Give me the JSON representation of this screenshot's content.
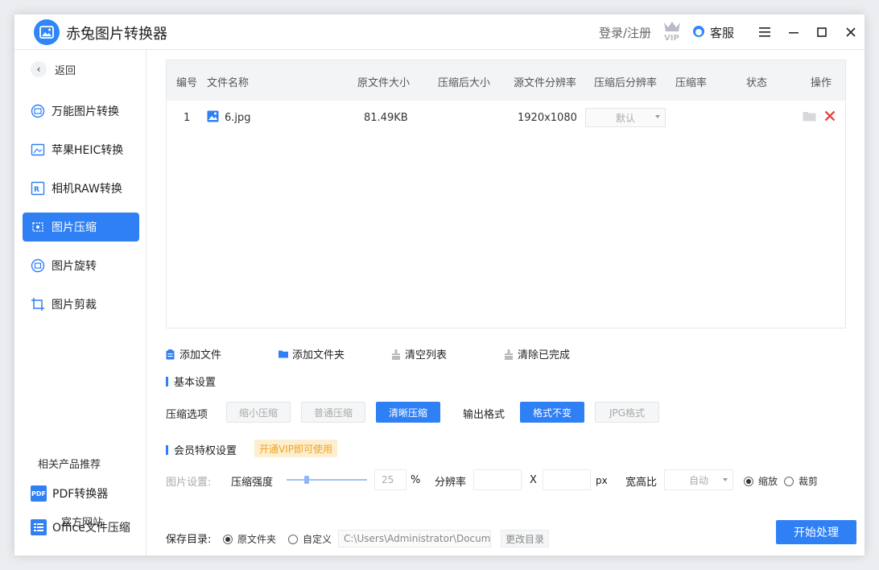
{
  "app": {
    "title": "赤兔图片转换器",
    "login": "登录/注册",
    "service": "客服"
  },
  "sidebar": {
    "back": "返回",
    "items": [
      {
        "label": "万能图片转换",
        "icon": "image-convert-icon"
      },
      {
        "label": "苹果HEIC转换",
        "icon": "heic-icon"
      },
      {
        "label": "相机RAW转换",
        "icon": "raw-icon"
      },
      {
        "label": "图片压缩",
        "icon": "compress-icon",
        "active": true
      },
      {
        "label": "图片旋转",
        "icon": "rotate-icon"
      },
      {
        "label": "图片剪裁",
        "icon": "crop-icon"
      }
    ],
    "recommend_title": "相关产品推荐",
    "recommend": [
      {
        "label": "PDF转换器",
        "icon_text": "PDF"
      },
      {
        "label": "Office文件压缩",
        "icon_text": ""
      }
    ],
    "official": "官方网站"
  },
  "table": {
    "headers": [
      "编号",
      "文件名称",
      "原文件大小",
      "压缩后大小",
      "源文件分辨率",
      "压缩后分辨率",
      "压缩率",
      "状态",
      "操作"
    ],
    "rows": [
      {
        "index": "1",
        "name": "6.jpg",
        "size": "81.49KB",
        "compressed": "",
        "resolution": "1920x1080",
        "target_res": "默认",
        "ratio": "",
        "status": ""
      }
    ]
  },
  "actions": {
    "add_file": "添加文件",
    "add_folder": "添加文件夹",
    "clear_list": "清空列表",
    "clear_done": "清除已完成"
  },
  "basic": {
    "title": "基本设置",
    "compress_label": "压缩选项",
    "compress_options": [
      "缩小压缩",
      "普通压缩",
      "清晰压缩"
    ],
    "compress_selected": "清晰压缩",
    "format_label": "输出格式",
    "format_options": [
      "格式不变",
      "JPG格式"
    ],
    "format_selected": "格式不变"
  },
  "vip": {
    "title": "会员特权设置",
    "badge": "开通VIP即可使用",
    "image_settings": "图片设置:",
    "strength_label": "压缩强度",
    "strength_value": "25",
    "strength_unit": "%",
    "resolution_label": "分辨率",
    "x": "X",
    "px": "px",
    "aspect_label": "宽高比",
    "aspect_value": "自动",
    "mode_options": [
      "缩放",
      "裁剪"
    ],
    "mode_selected": "缩放"
  },
  "save": {
    "label": "保存目录:",
    "options": [
      "原文件夹",
      "自定义"
    ],
    "selected": "原文件夹",
    "path": "C:\\Users\\Administrator\\Docume",
    "change": "更改目录"
  },
  "start": "开始处理",
  "colors": {
    "accent": "#2f7ff5",
    "delete": "#e53935",
    "vip_badge_bg": "#fdeecf",
    "vip_badge_text": "#f0a21e"
  }
}
